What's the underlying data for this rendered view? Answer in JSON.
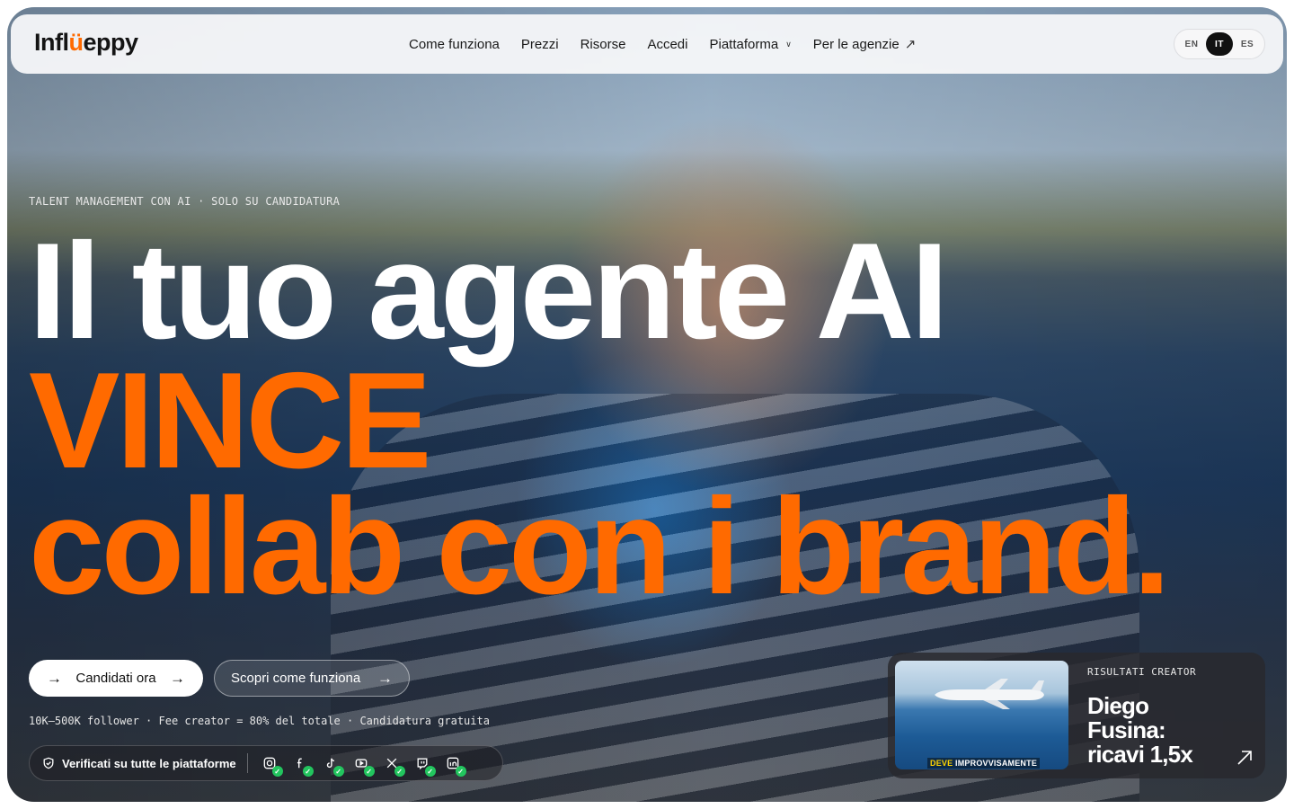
{
  "brand": {
    "logo_prefix": "Infl",
    "logo_mark": "ü",
    "logo_suffix": "eppy",
    "accent": "#ff6a00"
  },
  "nav": {
    "links": [
      "Come funziona",
      "Prezzi",
      "Risorse",
      "Accedi",
      "Piattaforma",
      "Per le agenzie"
    ],
    "languages": [
      "EN",
      "IT",
      "ES"
    ],
    "active_language": "IT"
  },
  "hero": {
    "eyebrow": "TALENT MANAGEMENT CON AI · SOLO SU CANDIDATURA",
    "line1": "Il tuo agente AI",
    "line2": "VINCE",
    "line3": "collab con i brand."
  },
  "cta": {
    "primary": "Candidati ora",
    "secondary": "Scopri come funziona"
  },
  "meta": "10K–500K follower · Fee creator = 80% del totale · Candidatura gratuita",
  "verify": {
    "label": "Verificati su tutte le piattaforme",
    "platforms": [
      "instagram-icon",
      "facebook-icon",
      "tiktok-icon",
      "youtube-icon",
      "x-icon",
      "twitch-icon",
      "linkedin-icon"
    ]
  },
  "result_card": {
    "label": "RISULTATI CREATOR",
    "title": "Diego Fusina: ricavi 1,5x",
    "thumb_caption_a": "DEVE",
    "thumb_caption_b": "IMPROVVISAMENTE"
  }
}
